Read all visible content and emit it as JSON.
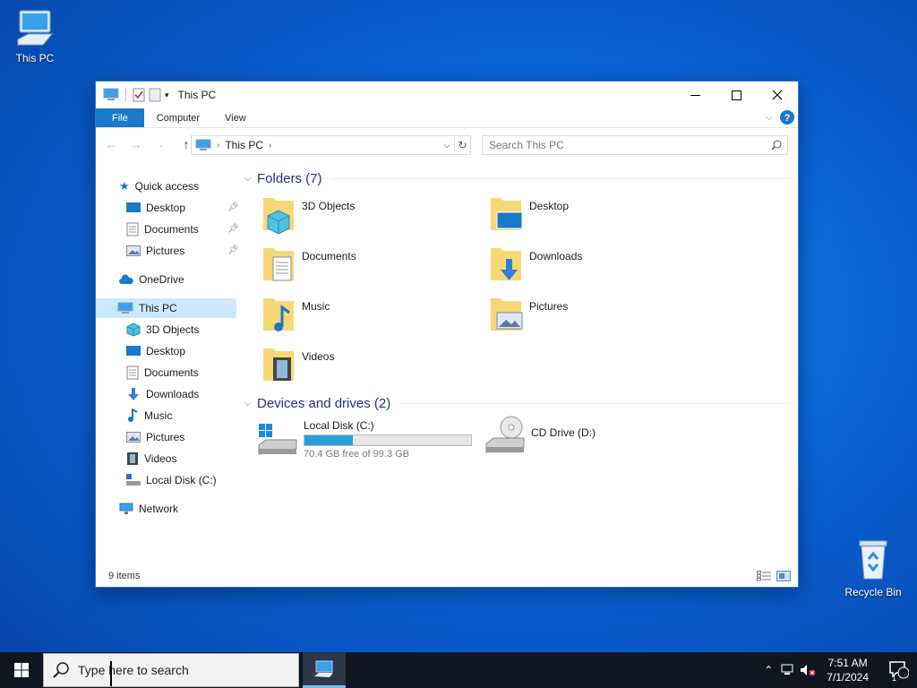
{
  "desktop": {
    "icons": [
      {
        "label": "This PC"
      },
      {
        "label": "Recycle Bin"
      }
    ]
  },
  "window": {
    "title": "This PC",
    "ribbon_tabs": [
      "File",
      "Computer",
      "View"
    ],
    "address": {
      "crumb": "This PC"
    },
    "search_placeholder": "Search This PC"
  },
  "nav_pane": {
    "quick_access": "Quick access",
    "quick_items": [
      "Desktop",
      "Documents",
      "Pictures"
    ],
    "onedrive": "OneDrive",
    "this_pc": "This PC",
    "pc_items": [
      "3D Objects",
      "Desktop",
      "Documents",
      "Downloads",
      "Music",
      "Pictures",
      "Videos",
      "Local Disk (C:)"
    ],
    "network": "Network"
  },
  "content": {
    "folders_header": "Folders (7)",
    "folders": [
      "3D Objects",
      "Desktop",
      "Documents",
      "Downloads",
      "Music",
      "Pictures",
      "Videos"
    ],
    "devices_header": "Devices and drives (2)",
    "drives": [
      {
        "name": "Local Disk (C:)",
        "free_text": "70.4 GB free of 99.3 GB",
        "used_fraction": 0.29
      },
      {
        "name": "CD Drive (D:)"
      }
    ]
  },
  "status": {
    "items": "9 items"
  },
  "taskbar": {
    "search_placeholder": "Type here to search",
    "time": "7:51 AM",
    "date": "7/1/2024",
    "notification_count": "1"
  },
  "colors": {
    "accent": "#1979ca",
    "folder": "#f8d775",
    "desktop": "#0a63d6",
    "taskbar": "#101621"
  }
}
